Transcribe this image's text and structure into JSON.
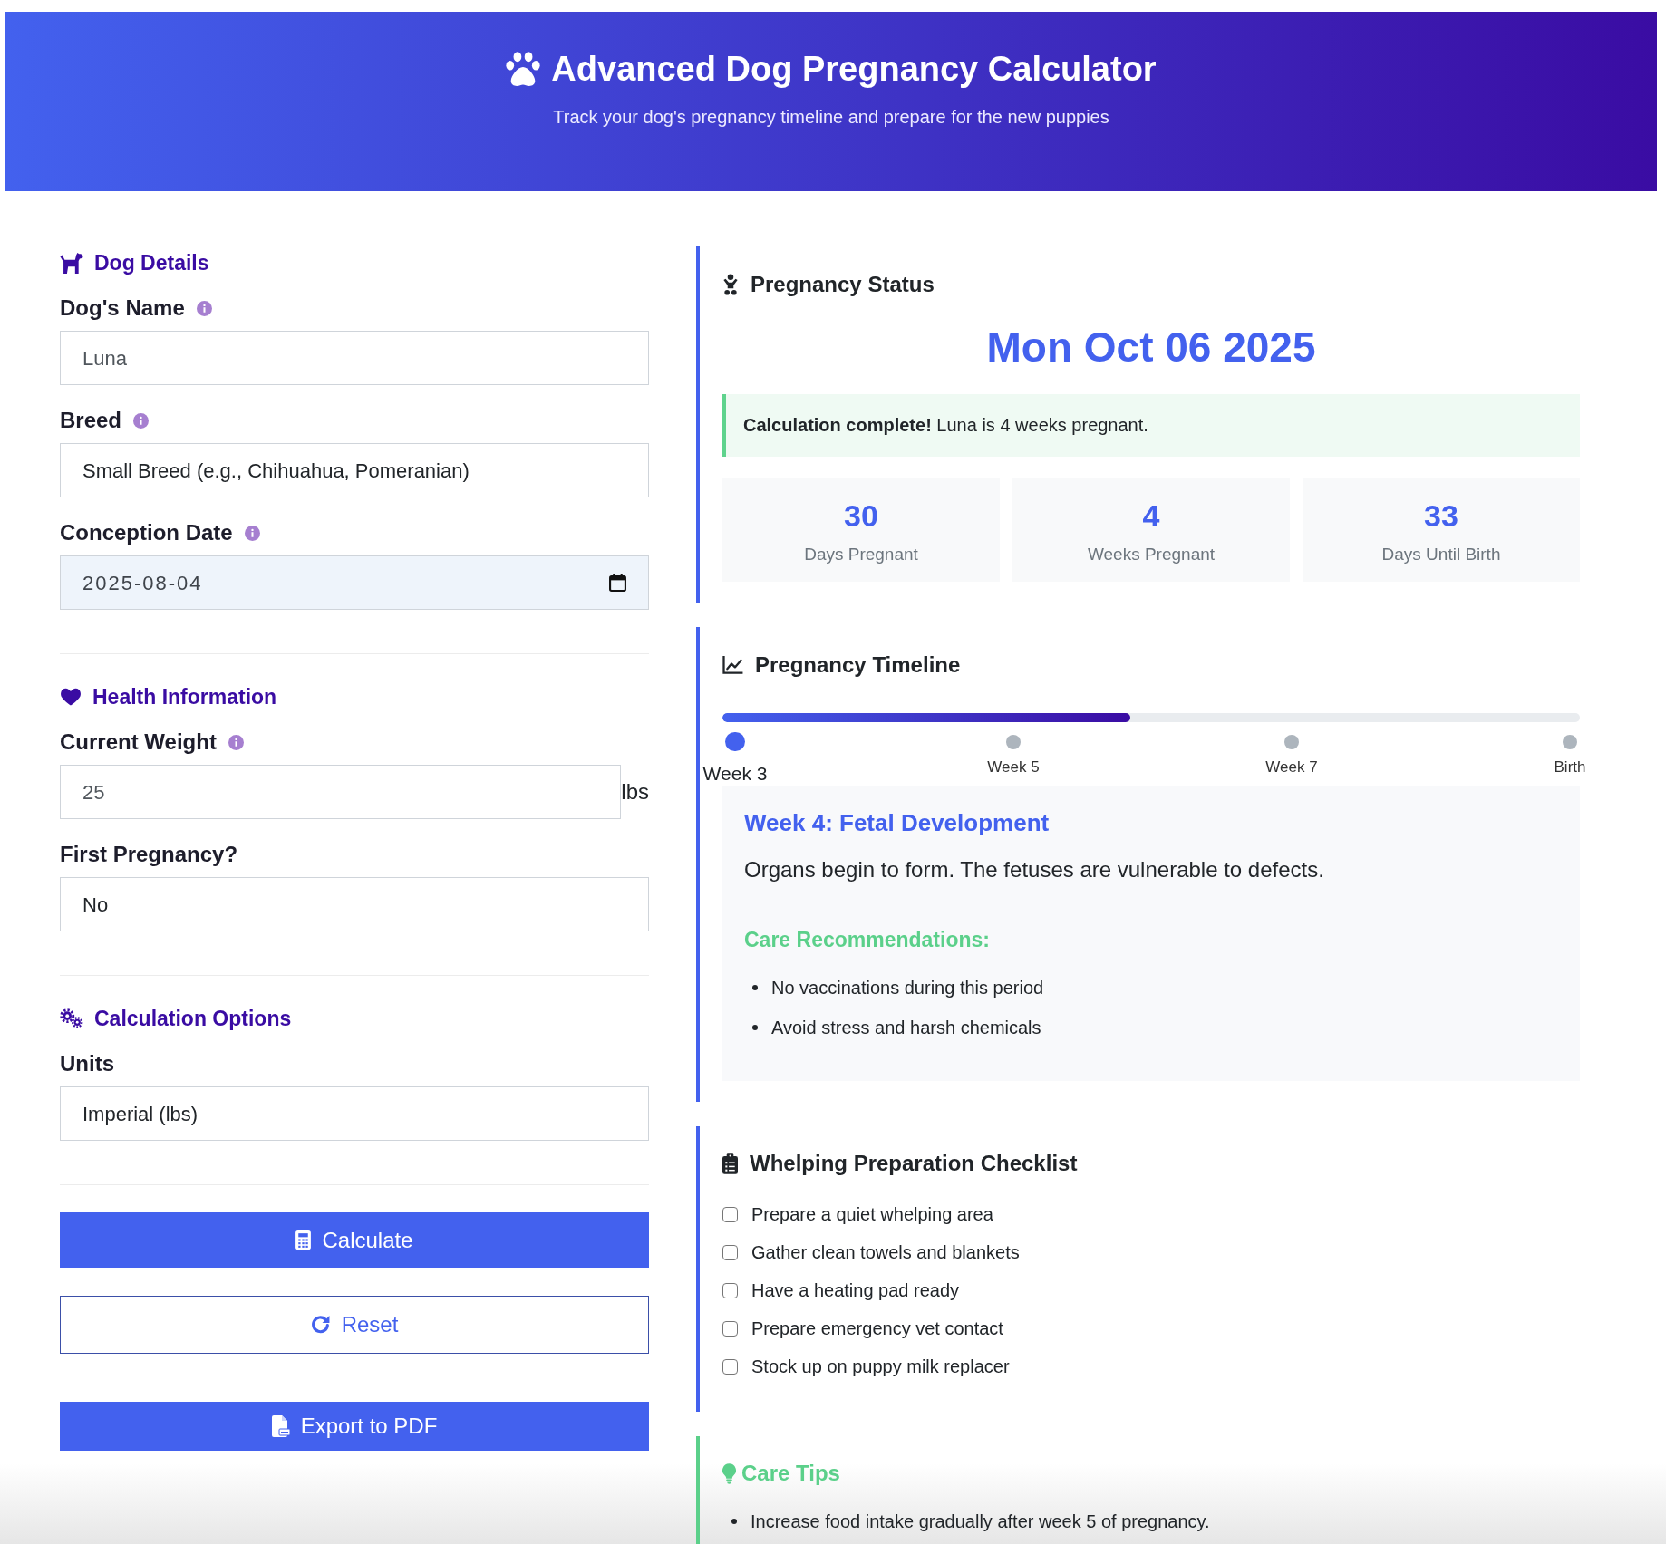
{
  "header": {
    "title": "Advanced Dog Pregnancy Calculator",
    "subtitle": "Track your dog's pregnancy timeline and prepare for the new puppies"
  },
  "form": {
    "sections": [
      {
        "title": "Dog Details",
        "fields": [
          {
            "label": "Dog's Name",
            "info": true,
            "kind": "input",
            "value": "Luna"
          },
          {
            "label": "Breed",
            "info": true,
            "kind": "select",
            "value": "Small Breed (e.g., Chihuahua, Pomeranian)"
          },
          {
            "label": "Conception Date",
            "info": true,
            "kind": "date",
            "value": "2025-08-04"
          }
        ]
      },
      {
        "title": "Health Information",
        "fields": [
          {
            "label": "Current Weight",
            "info": true,
            "kind": "input",
            "value": "25",
            "unit": "lbs"
          },
          {
            "label": "First Pregnancy?",
            "info": false,
            "kind": "select",
            "value": "No"
          }
        ]
      },
      {
        "title": "Calculation Options",
        "fields": [
          {
            "label": "Units",
            "info": false,
            "kind": "select",
            "value": "Imperial (lbs)"
          }
        ]
      }
    ],
    "buttons": [
      {
        "label": "Calculate",
        "kind": "primary"
      },
      {
        "label": "Reset",
        "kind": "outline"
      },
      {
        "label": "Export to PDF",
        "kind": "primary"
      }
    ]
  },
  "status": {
    "title": "Pregnancy Status",
    "due_date": "Mon Oct 06 2025",
    "alert": "**Calculation complete!** Luna is 4 weeks pregnant.",
    "stats": [
      {
        "value": "30",
        "label": "Days Pregnant"
      },
      {
        "value": "4",
        "label": "Weeks Pregnant"
      },
      {
        "value": "33",
        "label": "Days Until Birth"
      }
    ]
  },
  "timeline": {
    "title": "Pregnancy Timeline",
    "progress": {
      "level": 0.476
    },
    "milestones": [
      {
        "label": "Week 3",
        "selected": true
      },
      {
        "label": "Week 5",
        "selected": false
      },
      {
        "label": "Week 7",
        "selected": false
      },
      {
        "label": "Birth",
        "selected": false
      }
    ],
    "week_detail": {
      "title": "Week 4: Fetal Development",
      "description": "Organs begin to form. The fetuses are vulnerable to defects.",
      "care_title": "Care Recommendations:",
      "care_items": [
        "No vaccinations during this period",
        "Avoid stress and harsh chemicals"
      ]
    }
  },
  "checklist": {
    "title": "Whelping Preparation Checklist",
    "items": [
      {
        "label": "Prepare a quiet whelping area",
        "checked": false
      },
      {
        "label": "Gather clean towels and blankets",
        "checked": false
      },
      {
        "label": "Have a heating pad ready",
        "checked": false
      },
      {
        "label": "Prepare emergency vet contact",
        "checked": false
      },
      {
        "label": "Stock up on puppy milk replacer",
        "checked": false
      }
    ]
  },
  "care_tips": {
    "title": "Care Tips",
    "items": [
      "Increase food intake gradually after week 5 of pregnancy."
    ]
  }
}
